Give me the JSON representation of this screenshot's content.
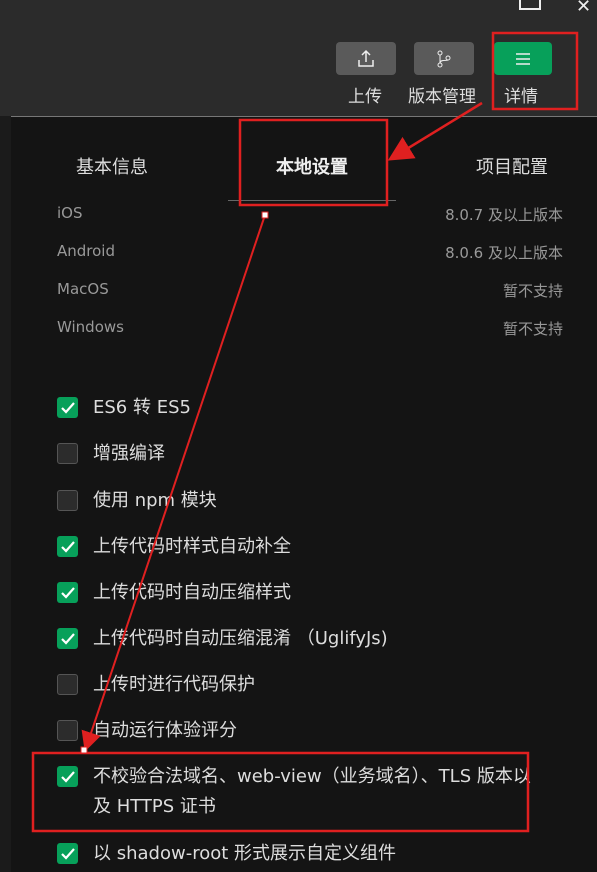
{
  "toolbar": {
    "upload": "上传",
    "version": "版本管理",
    "details": "详情"
  },
  "tabs": [
    "基本信息",
    "本地设置",
    "项目配置"
  ],
  "info": [
    {
      "label": "iOS",
      "value": "8.0.7 及以上版本"
    },
    {
      "label": "Android",
      "value": "8.0.6 及以上版本"
    },
    {
      "label": "MacOS",
      "value": "暂不支持"
    },
    {
      "label": "Windows",
      "value": "暂不支持"
    }
  ],
  "settings": [
    {
      "label": "ES6 转 ES5",
      "checked": true
    },
    {
      "label": "增强编译",
      "checked": false
    },
    {
      "label": "使用 npm 模块",
      "checked": false
    },
    {
      "label": "上传代码时样式自动补全",
      "checked": true
    },
    {
      "label": "上传代码时自动压缩样式",
      "checked": true
    },
    {
      "label": "上传代码时自动压缩混淆 （UglifyJs)",
      "checked": true
    },
    {
      "label": "上传时进行代码保护",
      "checked": false
    },
    {
      "label": "自动运行体验评分",
      "checked": false
    },
    {
      "label": "不校验合法域名、web-view（业务域名）、TLS 版本以及 HTTPS 证书",
      "checked": true
    },
    {
      "label": "以 shadow-root 形式展示自定义组件",
      "checked": true
    }
  ],
  "colors": {
    "accent": "#07a05a",
    "annotation": "#e02020"
  }
}
